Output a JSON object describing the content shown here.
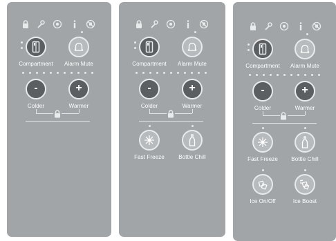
{
  "panels": [
    {
      "id": "panel-basic",
      "labels": {
        "compartment": "Compartment",
        "alarm_mute": "Alarm Mute",
        "colder": "Colder",
        "warmer": "Warmer"
      },
      "minus": "-",
      "plus": "+"
    },
    {
      "id": "panel-fast-freeze",
      "labels": {
        "compartment": "Compartment",
        "alarm_mute": "Alarm Mute",
        "colder": "Colder",
        "warmer": "Warmer",
        "fast_freeze": "Fast Freeze",
        "bottle_chill": "Bottle Chill"
      },
      "minus": "-",
      "plus": "+"
    },
    {
      "id": "panel-ice",
      "labels": {
        "compartment": "Compartment",
        "alarm_mute": "Alarm Mute",
        "colder": "Colder",
        "warmer": "Warmer",
        "fast_freeze": "Fast Freeze",
        "bottle_chill": "Bottle Chill",
        "ice_on_off": "Ice On/Off",
        "ice_boost": "Ice Boost"
      },
      "minus": "-",
      "plus": "+"
    }
  ],
  "status_icons": [
    "lock-icon",
    "wrench-icon",
    "filter-icon",
    "info-icon",
    "alarm-off-icon"
  ],
  "colors": {
    "panel": "#a1a5a8",
    "button_dark": "#5c5f62",
    "button_light": "#b8bbbe",
    "text": "#ffffff"
  }
}
